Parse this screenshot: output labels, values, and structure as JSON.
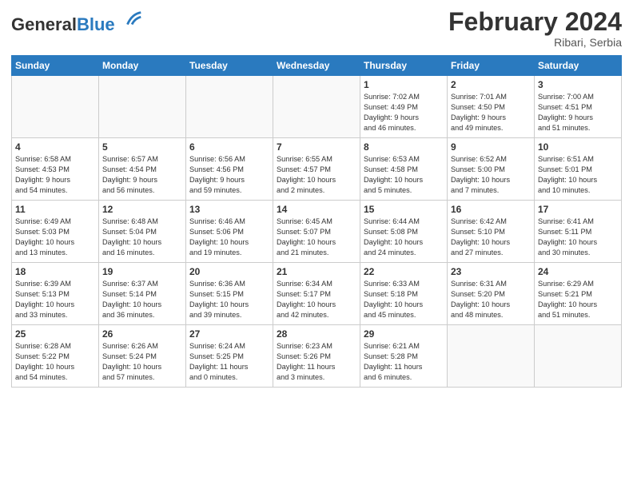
{
  "header": {
    "logo_general": "General",
    "logo_blue": "Blue",
    "month_title": "February 2024",
    "location": "Ribari, Serbia"
  },
  "weekdays": [
    "Sunday",
    "Monday",
    "Tuesday",
    "Wednesday",
    "Thursday",
    "Friday",
    "Saturday"
  ],
  "weeks": [
    [
      {
        "day": "",
        "info": ""
      },
      {
        "day": "",
        "info": ""
      },
      {
        "day": "",
        "info": ""
      },
      {
        "day": "",
        "info": ""
      },
      {
        "day": "1",
        "info": "Sunrise: 7:02 AM\nSunset: 4:49 PM\nDaylight: 9 hours\nand 46 minutes."
      },
      {
        "day": "2",
        "info": "Sunrise: 7:01 AM\nSunset: 4:50 PM\nDaylight: 9 hours\nand 49 minutes."
      },
      {
        "day": "3",
        "info": "Sunrise: 7:00 AM\nSunset: 4:51 PM\nDaylight: 9 hours\nand 51 minutes."
      }
    ],
    [
      {
        "day": "4",
        "info": "Sunrise: 6:58 AM\nSunset: 4:53 PM\nDaylight: 9 hours\nand 54 minutes."
      },
      {
        "day": "5",
        "info": "Sunrise: 6:57 AM\nSunset: 4:54 PM\nDaylight: 9 hours\nand 56 minutes."
      },
      {
        "day": "6",
        "info": "Sunrise: 6:56 AM\nSunset: 4:56 PM\nDaylight: 9 hours\nand 59 minutes."
      },
      {
        "day": "7",
        "info": "Sunrise: 6:55 AM\nSunset: 4:57 PM\nDaylight: 10 hours\nand 2 minutes."
      },
      {
        "day": "8",
        "info": "Sunrise: 6:53 AM\nSunset: 4:58 PM\nDaylight: 10 hours\nand 5 minutes."
      },
      {
        "day": "9",
        "info": "Sunrise: 6:52 AM\nSunset: 5:00 PM\nDaylight: 10 hours\nand 7 minutes."
      },
      {
        "day": "10",
        "info": "Sunrise: 6:51 AM\nSunset: 5:01 PM\nDaylight: 10 hours\nand 10 minutes."
      }
    ],
    [
      {
        "day": "11",
        "info": "Sunrise: 6:49 AM\nSunset: 5:03 PM\nDaylight: 10 hours\nand 13 minutes."
      },
      {
        "day": "12",
        "info": "Sunrise: 6:48 AM\nSunset: 5:04 PM\nDaylight: 10 hours\nand 16 minutes."
      },
      {
        "day": "13",
        "info": "Sunrise: 6:46 AM\nSunset: 5:06 PM\nDaylight: 10 hours\nand 19 minutes."
      },
      {
        "day": "14",
        "info": "Sunrise: 6:45 AM\nSunset: 5:07 PM\nDaylight: 10 hours\nand 21 minutes."
      },
      {
        "day": "15",
        "info": "Sunrise: 6:44 AM\nSunset: 5:08 PM\nDaylight: 10 hours\nand 24 minutes."
      },
      {
        "day": "16",
        "info": "Sunrise: 6:42 AM\nSunset: 5:10 PM\nDaylight: 10 hours\nand 27 minutes."
      },
      {
        "day": "17",
        "info": "Sunrise: 6:41 AM\nSunset: 5:11 PM\nDaylight: 10 hours\nand 30 minutes."
      }
    ],
    [
      {
        "day": "18",
        "info": "Sunrise: 6:39 AM\nSunset: 5:13 PM\nDaylight: 10 hours\nand 33 minutes."
      },
      {
        "day": "19",
        "info": "Sunrise: 6:37 AM\nSunset: 5:14 PM\nDaylight: 10 hours\nand 36 minutes."
      },
      {
        "day": "20",
        "info": "Sunrise: 6:36 AM\nSunset: 5:15 PM\nDaylight: 10 hours\nand 39 minutes."
      },
      {
        "day": "21",
        "info": "Sunrise: 6:34 AM\nSunset: 5:17 PM\nDaylight: 10 hours\nand 42 minutes."
      },
      {
        "day": "22",
        "info": "Sunrise: 6:33 AM\nSunset: 5:18 PM\nDaylight: 10 hours\nand 45 minutes."
      },
      {
        "day": "23",
        "info": "Sunrise: 6:31 AM\nSunset: 5:20 PM\nDaylight: 10 hours\nand 48 minutes."
      },
      {
        "day": "24",
        "info": "Sunrise: 6:29 AM\nSunset: 5:21 PM\nDaylight: 10 hours\nand 51 minutes."
      }
    ],
    [
      {
        "day": "25",
        "info": "Sunrise: 6:28 AM\nSunset: 5:22 PM\nDaylight: 10 hours\nand 54 minutes."
      },
      {
        "day": "26",
        "info": "Sunrise: 6:26 AM\nSunset: 5:24 PM\nDaylight: 10 hours\nand 57 minutes."
      },
      {
        "day": "27",
        "info": "Sunrise: 6:24 AM\nSunset: 5:25 PM\nDaylight: 11 hours\nand 0 minutes."
      },
      {
        "day": "28",
        "info": "Sunrise: 6:23 AM\nSunset: 5:26 PM\nDaylight: 11 hours\nand 3 minutes."
      },
      {
        "day": "29",
        "info": "Sunrise: 6:21 AM\nSunset: 5:28 PM\nDaylight: 11 hours\nand 6 minutes."
      },
      {
        "day": "",
        "info": ""
      },
      {
        "day": "",
        "info": ""
      }
    ]
  ]
}
